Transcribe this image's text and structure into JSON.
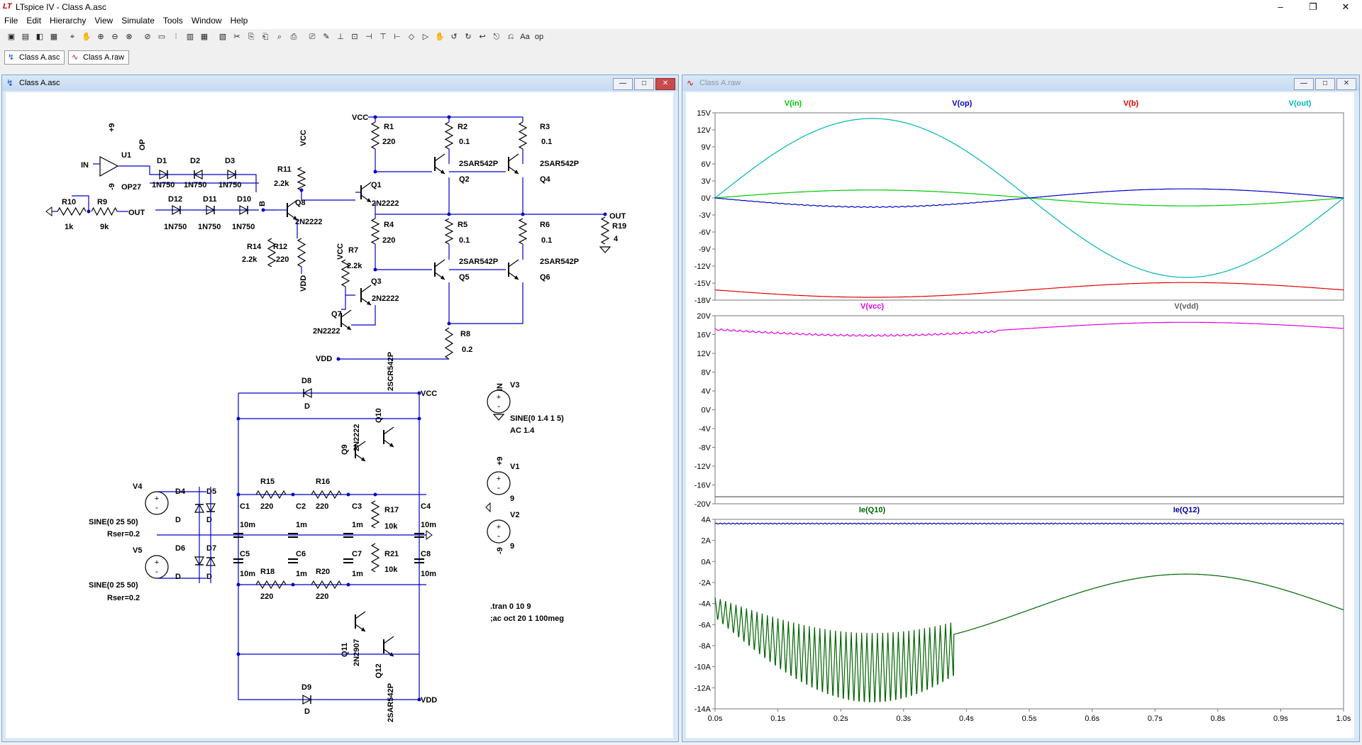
{
  "window": {
    "title": "LTspice IV - Class A.asc",
    "app_icon": "LT"
  },
  "menu": [
    "File",
    "Edit",
    "Hierarchy",
    "View",
    "Simulate",
    "Tools",
    "Window",
    "Help"
  ],
  "tabs": [
    {
      "label": "Class A.asc"
    },
    {
      "label": "Class A.raw"
    }
  ],
  "schematic": {
    "title": "Class A.asc"
  },
  "plot": {
    "title": "Class A.raw",
    "pane1": {
      "traces": [
        {
          "name": "V(in)",
          "color": "#00c800"
        },
        {
          "name": "V(op)",
          "color": "#0000c8"
        },
        {
          "name": "V(b)",
          "color": "#e00000"
        },
        {
          "name": "V(out)",
          "color": "#00b4b4"
        }
      ],
      "yticks": [
        "15V",
        "12V",
        "9V",
        "6V",
        "3V",
        "0V",
        "-3V",
        "-6V",
        "-9V",
        "-12V",
        "-15V",
        "-18V"
      ]
    },
    "pane2": {
      "traces": [
        {
          "name": "V(vcc)",
          "color": "#e000e0"
        },
        {
          "name": "V(vdd)",
          "color": "#606060"
        }
      ],
      "yticks": [
        "20V",
        "16V",
        "12V",
        "8V",
        "4V",
        "0V",
        "-4V",
        "-8V",
        "-12V",
        "-16V",
        "-20V"
      ]
    },
    "pane3": {
      "traces": [
        {
          "name": "Ie(Q10)",
          "color": "#006400"
        },
        {
          "name": "Ie(Q12)",
          "color": "#0000a0"
        }
      ],
      "yticks": [
        "4A",
        "2A",
        "0A",
        "-2A",
        "-4A",
        "-6A",
        "-8A",
        "-10A",
        "-12A",
        "-14A"
      ]
    },
    "xticks": [
      "0.0s",
      "0.1s",
      "0.2s",
      "0.3s",
      "0.4s",
      "0.5s",
      "0.6s",
      "0.7s",
      "0.8s",
      "0.9s",
      "1.0s"
    ]
  },
  "labels": {
    "VCC": "VCC",
    "VDD": "VDD",
    "IN": "IN",
    "OUT": "OUT",
    "OP": "OP",
    "B": "B",
    "+9": "+9",
    "-9": "-9",
    "U1": "U1",
    "OP27": "OP27",
    "D1": "D1",
    "D2": "D2",
    "D3": "D3",
    "D10": "D10",
    "D11": "D11",
    "D12": "D12",
    "N750": "1N750",
    "R10": "R10",
    "1k": "1k",
    "R9": "R9",
    "9k": "9k",
    "R11": "R11",
    "2.2k": "2.2k",
    "Q8": "Q8",
    "2N2222": "2N2222",
    "R14": "R14",
    "R12": "R12",
    "220": "220",
    "R1": "R1",
    "R4": "R4",
    "R7": "R7",
    "Q1": "Q1",
    "Q3": "Q3",
    "Q7": "Q7",
    "R2": "R2",
    "R3": "R3",
    "R5": "R5",
    "R6": "R6",
    "0.1": "0.1",
    "2SAR542P": "2SAR542P",
    "Q2": "Q2",
    "Q4": "Q4",
    "Q5": "Q5",
    "Q6": "Q6",
    "R19": "R19",
    "4": "4",
    "R8": "R8",
    "0.2": "0.2",
    "D8": "D8",
    "D9": "D9",
    "D": "D",
    "Q10": "Q10",
    "2SCR542P": "2SCR542P",
    "Q9": "Q9",
    "Q11": "Q11",
    "2N2907": "2N2907",
    "Q12": "Q12",
    "V4": "V4",
    "V5": "V5",
    "D4": "D4",
    "D5": "D5",
    "D6": "D6",
    "D7": "D7",
    "SINE": "SINE(0 25 50)",
    "Rser": "Rser=0.2",
    "R15": "R15",
    "R16": "R16",
    "R17": "R17",
    "R18": "R18",
    "R20": "R20",
    "R21": "R21",
    "10k": "10k",
    "C1": "C1",
    "C2": "C2",
    "C3": "C3",
    "C4": "C4",
    "C5": "C5",
    "C6": "C6",
    "C7": "C7",
    "C8": "C8",
    "10m": "10m",
    "1m": "1m",
    "V3": "V3",
    "V3src": "SINE(0 1.4 1 5)",
    "V3ac": "AC 1.4",
    "V1": "V1",
    "V2": "V2",
    "9": "9",
    "tran": ".tran 0 10 9",
    "ac": ";ac oct 20 1 100meg"
  }
}
